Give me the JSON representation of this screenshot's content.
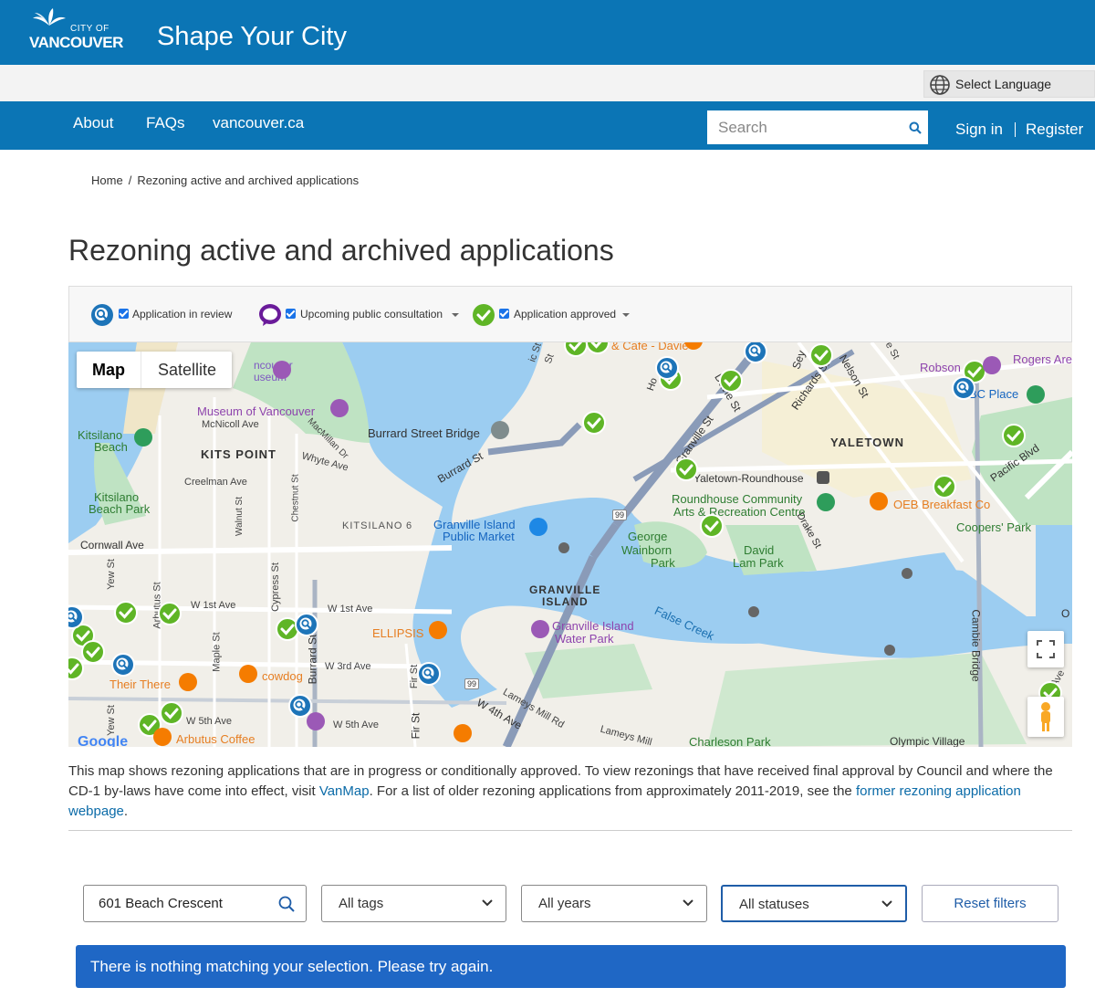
{
  "header": {
    "logo_small": "CITY OF",
    "logo_large": "VANCOUVER",
    "site_title": "Shape Your City"
  },
  "language": {
    "label": "Select Language",
    "icon": "globe-icon"
  },
  "nav": {
    "links": [
      "About",
      "FAQs",
      "vancouver.ca"
    ],
    "search_placeholder": "Search",
    "sign_in": "Sign in",
    "register": "Register"
  },
  "breadcrumb": {
    "home": "Home",
    "separator": "/",
    "current": "Rezoning active and archived applications"
  },
  "page_title": "Rezoning active and archived applications",
  "legend": {
    "items": [
      {
        "label": "Application in review",
        "icon": "magnifier-marker-icon",
        "checked": true
      },
      {
        "label": "Upcoming public consultation",
        "icon": "speech-bubble-marker-icon",
        "checked": true
      },
      {
        "label": "Application approved",
        "icon": "check-marker-icon",
        "checked": true
      }
    ]
  },
  "map": {
    "type_buttons": [
      "Map",
      "Satellite"
    ],
    "selected_type": "Map",
    "attribution": "Google",
    "labels": {
      "kits_point": "KITS POINT",
      "yaletown": "YALETOWN",
      "granville_island_1": "GRANVILLE",
      "granville_island_2": "ISLAND",
      "kitsilano": "KITSILANO",
      "kitsilano_route": "6",
      "museum": "Museum of Vancouver",
      "museum_partial_1": "ncouver",
      "museum_partial_2": "useum",
      "kitsilano_beach_1": "Kitsilano",
      "kitsilano_beach_2": "Beach",
      "kitsilano_beach_park_1": "Kitsilano",
      "kitsilano_beach_park_2": "Beach Park",
      "burrard_bridge": "Burrard Street Bridge",
      "burrard_st": "Burrard St",
      "burrard_st_south": "Burrard St",
      "macmillan_dr": "MacMillan Dr",
      "mcnicoll_ave": "McNicoll Ave",
      "whyte_ave": "Whyte Ave",
      "creelman_ave": "Creelman Ave",
      "cornwall_ave": "Cornwall Ave",
      "w1st_ave_a": "W 1st Ave",
      "w1st_ave_b": "W 1st Ave",
      "w3rd_ave": "W 3rd Ave",
      "w4th_ave": "W 4th Ave",
      "w5th_ave_a": "W 5th Ave",
      "w5th_ave_b": "W 5th Ave",
      "lameys_mill_1": "Lameys Mill Rd",
      "lameys_mill_2": "Lameys Mill",
      "walnut_st": "Walnut St",
      "chestnut_st": "Chestnut St",
      "cypress_st": "Cypress St",
      "maple_st": "Maple St",
      "arbutus_st": "Arbutus St",
      "yew_st_a": "Yew St",
      "yew_st_b": "Yew St",
      "fir_st_a": "Fir St",
      "fir_st_b": "Fir St",
      "granville_market_1": "Granville Island",
      "granville_market_2": "Public Market",
      "water_park_1": "Granville Island",
      "water_park_2": "Water Park",
      "ellipsis": "ELLIPSIS",
      "their_there": "Their There",
      "cowdog": "cowdog",
      "arbutus_coffee": "Arbutus Coffee",
      "false_creek": "False Creek",
      "george_wainborn_1": "George",
      "george_wainborn_2": "Wainborn",
      "george_wainborn_3": "Park",
      "david_lam_1": "David",
      "david_lam_2": "Lam Park",
      "roundhouse_1": "Roundhouse Community",
      "roundhouse_2": "Arts & Recreation Centre",
      "yaletown_roundhouse": "Yaletown-Roundhouse",
      "oeb": "OEB Breakfast Co",
      "coopers_park": "Coopers' Park",
      "pacific_blvd": "Pacific Blvd",
      "cambie_bridge": "Cambie Bridge",
      "bc_place": "BC Place",
      "rogers_arena": "Rogers Are",
      "robson": "Robson",
      "granville_st": "Granville St",
      "davie_st": "Davie St",
      "richards_st": "Richards St",
      "seymour": "Sey",
      "nelson_st": "Nelson St",
      "homer": "Ho",
      "cafe_davie": "& Cafe - Davie",
      "drake_st": "Drake St",
      "charleson_park": "Charleson Park",
      "olympic_village": "Olympic Village",
      "hwy99_a": "99",
      "hwy99_b": "99",
      "partial_st_1": "ic St",
      "partial_st_2": "St",
      "partial_st_3": "e St",
      "partial_ave": "Ave",
      "partial_o": "O"
    }
  },
  "description": {
    "text_1": "This map shows rezoning applications that are in progress or conditionally approved. To view rezonings that have received final approval by Council and where the CD-1 by-laws have come into effect, visit ",
    "link_1": "VanMap",
    "text_2": ". For a list of older rezoning applications from approximately 2011-2019, see the ",
    "link_2": "former rezoning application webpage",
    "text_3": "."
  },
  "filters": {
    "search_value": "601 Beach Crescent",
    "tags": "All tags",
    "years": "All years",
    "statuses": "All statuses",
    "reset": "Reset filters"
  },
  "alert": "There is nothing matching your selection. Please try again.",
  "colors": {
    "brand_blue": "#0b75b5",
    "alert_blue": "#1f67c5",
    "approved_green": "#5fb526",
    "review_blue": "#1d74b8",
    "consult_purple": "#6a1b9a"
  }
}
